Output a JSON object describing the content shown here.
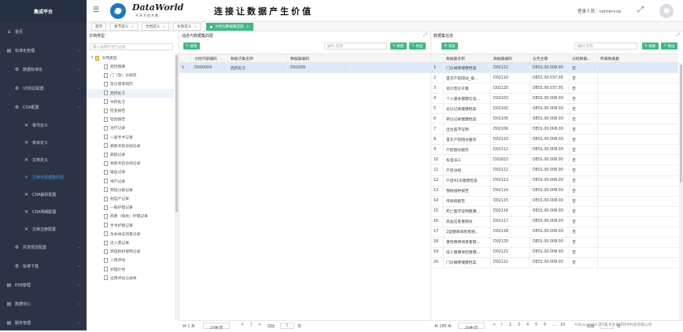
{
  "brand": "集成平台",
  "nav": [
    {
      "label": "首页",
      "icon": "home-icon",
      "level": 0,
      "chev": false
    },
    {
      "label": "标准化管理",
      "icon": "doc-icon",
      "level": 0,
      "chev": true
    },
    {
      "label": "数据标准化",
      "icon": "gear-icon",
      "level": 1,
      "chev": true
    },
    {
      "label": "V3协议配置",
      "icon": "gear-icon",
      "level": 1,
      "chev": true
    },
    {
      "label": "CDA配置",
      "icon": "gear-icon",
      "level": 1,
      "chev": true
    },
    {
      "label": "章节定义",
      "icon": "tool-icon",
      "level": 2,
      "chev": false
    },
    {
      "label": "条目定义",
      "icon": "tool-icon",
      "level": 2,
      "chev": false
    },
    {
      "label": "文档定义",
      "icon": "tool-icon",
      "level": 2,
      "chev": false
    },
    {
      "label": "文档与数据集匹配",
      "icon": "tool-icon",
      "level": 2,
      "chev": false,
      "active": true
    },
    {
      "label": "CDA解析配置",
      "icon": "tool-icon",
      "level": 2,
      "chev": false
    },
    {
      "label": "CDA明细配置",
      "icon": "tool-icon",
      "level": 2,
      "chev": false
    },
    {
      "label": "文档注册配置",
      "icon": "tool-icon",
      "level": 2,
      "chev": false
    },
    {
      "label": "共享规范配置",
      "icon": "gear-icon",
      "level": 1,
      "chev": true
    },
    {
      "label": "标准下载",
      "icon": "gear-icon",
      "level": 1,
      "chev": true
    },
    {
      "label": "ESB管理",
      "icon": "doc-icon",
      "level": 0,
      "chev": true
    },
    {
      "label": "数据中心",
      "icon": "doc-icon",
      "level": 0,
      "chev": true
    },
    {
      "label": "服务管理",
      "icon": "doc-icon",
      "level": 0,
      "chev": true
    }
  ],
  "header": {
    "logo_title": "DataWorld",
    "logo_sub": "共享开放共赢",
    "slogan": "连接让数据产生价值",
    "user_label": "登录人员：",
    "user_name": "centervue"
  },
  "tabs": [
    {
      "label": "首页",
      "closable": false
    },
    {
      "label": "章节定义",
      "closable": true
    },
    {
      "label": "文档定义",
      "closable": true
    },
    {
      "label": "条目定义",
      "closable": true
    },
    {
      "label": "文档与数据集匹配",
      "closable": true,
      "active": true
    }
  ],
  "left_panel": {
    "title": "文档类型",
    "search_placeholder": "输入关键字进行过滤",
    "root": "文档类型",
    "items": [
      "病历概要",
      "门（急）诊病历",
      "急诊留观病历",
      "西药处方",
      "中药处方",
      "检查报告",
      "检验报告",
      "治疗记录",
      "一般手术记录",
      "麻醉术前访视记录",
      "麻醉记录",
      "麻醉术后访视记录",
      "输血记录",
      "待产记录",
      "阴道分娩记录",
      "剖宫产记录",
      "一般护理记录",
      "病重（病危）护理记录",
      "手术护理记录",
      "生命体征测量记录",
      "出入量记录",
      "高值耗材使用记录",
      "入院评估",
      "护理计划",
      "出院评估与指导"
    ],
    "highlight_index": 3
  },
  "mid_panel": {
    "title": "消息与数据集匹配",
    "edit_btn": "修改",
    "search_placeholder": "编码,名称",
    "refresh_btn": "刷新",
    "export_btn": "导出",
    "columns": [
      "文档内部编码",
      "数据子集名称",
      "数据集编码"
    ],
    "rows": [
      {
        "no": "1",
        "code": "D000004",
        "name": "西药处方",
        "ds": "D01009"
      }
    ],
    "total": "共 1 条",
    "page_size": "20条/页",
    "goto": "前往",
    "page": "1",
    "page_unit": "页"
  },
  "right_panel": {
    "title": "数据集信息",
    "browse_btn": "浏览",
    "search_placeholder": "编码,名称",
    "refresh_btn": "刷新",
    "export_btn": "导出",
    "columns": [
      "数据集名称",
      "数据集编码",
      "业务主键",
      "过程数据...",
      "所属数据集"
    ],
    "rows": [
      {
        "no": "1",
        "name": "门诊摘要健康档案",
        "code": "D02122",
        "key": "DE01.00.008.00",
        "proc": "否"
      },
      {
        "no": "2",
        "name": "首次产前随访_报...",
        "code": "D02110",
        "key": "DE01.00.037.05",
        "proc": "否"
      },
      {
        "no": "3",
        "name": "会诊意见子集",
        "code": "D02120",
        "key": "DE01.00.037.05",
        "proc": "否"
      },
      {
        "no": "4",
        "name": "个人基本健康信息...",
        "code": "D02103",
        "key": "DE01.00.008.00",
        "proc": "否"
      },
      {
        "no": "5",
        "name": "会诊记录健康档案",
        "code": "D02102",
        "key": "DE01.00.008.00",
        "proc": "否"
      },
      {
        "no": "6",
        "name": "转诊记录健康档案",
        "code": "D02105",
        "key": "DE01.00.008.00",
        "proc": "否"
      },
      {
        "no": "7",
        "name": "出生医学证明",
        "code": "D02106",
        "key": "DE01.00.008.00",
        "proc": "否"
      },
      {
        "no": "8",
        "name": "首次产前随访服务",
        "code": "D02110",
        "key": "DE01.00.008.00",
        "proc": "否"
      },
      {
        "no": "9",
        "name": "产前随访服务",
        "code": "D02111",
        "key": "DE01.00.008.00",
        "proc": "否"
      },
      {
        "no": "10",
        "name": "科室员工",
        "code": "D02823",
        "key": "DE01.00.008.00",
        "proc": "否"
      },
      {
        "no": "11",
        "name": "产后访视",
        "code": "D02112",
        "key": "DE01.00.008.00",
        "proc": "否"
      },
      {
        "no": "12",
        "name": "产后42天健康检查",
        "code": "D02113",
        "key": "DE01.00.008.00",
        "proc": "否"
      },
      {
        "no": "13",
        "name": "预防接种报告",
        "code": "D02114",
        "key": "DE01.00.008.00",
        "proc": "否"
      },
      {
        "no": "14",
        "name": "传染病报告",
        "code": "D02115",
        "key": "DE01.00.008.00",
        "proc": "否"
      },
      {
        "no": "15",
        "name": "死亡医学证明健康...",
        "code": "D02116",
        "key": "DE01.00.008.00",
        "proc": "否"
      },
      {
        "no": "16",
        "name": "高血压患者随访",
        "code": "D02117",
        "key": "DE01.00.008.00",
        "proc": "否"
      },
      {
        "no": "17",
        "name": "2型糖尿病患者随...",
        "code": "D02118",
        "key": "DE01.00.008.00",
        "proc": "否"
      },
      {
        "no": "18",
        "name": "重性精神病患者随...",
        "code": "D02120",
        "key": "DE01.00.008.00",
        "proc": "否"
      },
      {
        "no": "19",
        "name": "成人健康体检健康...",
        "code": "D02121",
        "key": "DE01.00.008.00",
        "proc": "否"
      },
      {
        "no": "20",
        "name": "门诊摘要健康档案",
        "code": "D02122",
        "key": "DE01.00.008.00",
        "proc": "否"
      }
    ],
    "total": "共 189 条",
    "page_size": "20条/页",
    "pages": [
      "1",
      "2",
      "3",
      "4",
      "5",
      "6"
    ],
    "more": "...",
    "last_page": "10",
    "next": ">",
    "goto": "前往",
    "page": "1",
    "page_unit": "页"
  },
  "copyright": "© Copyright 2016 长沙谦讯软件科技有限公司"
}
